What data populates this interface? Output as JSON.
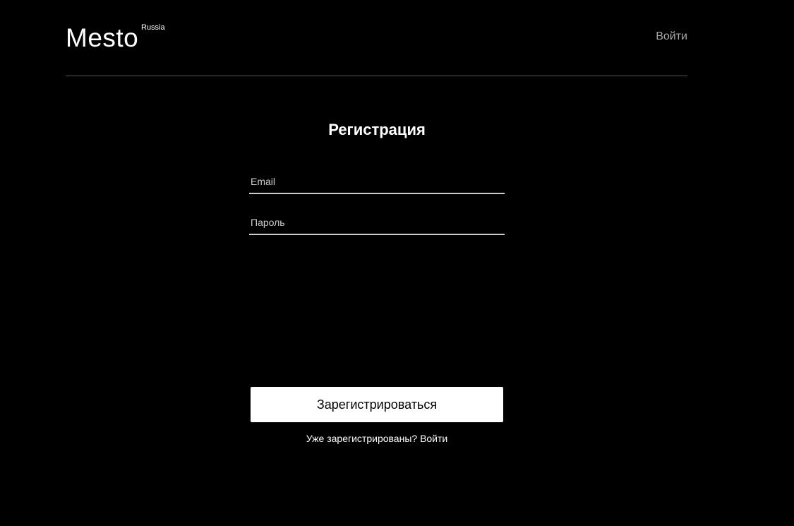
{
  "header": {
    "logo_text": "Mesto",
    "logo_superscript": "Russia",
    "nav_link": "Войти"
  },
  "form": {
    "title": "Регистрация",
    "email_placeholder": "Email",
    "password_placeholder": "Пароль",
    "submit_label": "Зарегистрироваться",
    "switch_text": "Уже зарегистрированы?",
    "switch_link": "Войти"
  },
  "colors": {
    "background": "#000000",
    "text": "#ffffff",
    "muted": "#a9a9a9",
    "divider": "#545454",
    "button_bg": "#ffffff"
  }
}
